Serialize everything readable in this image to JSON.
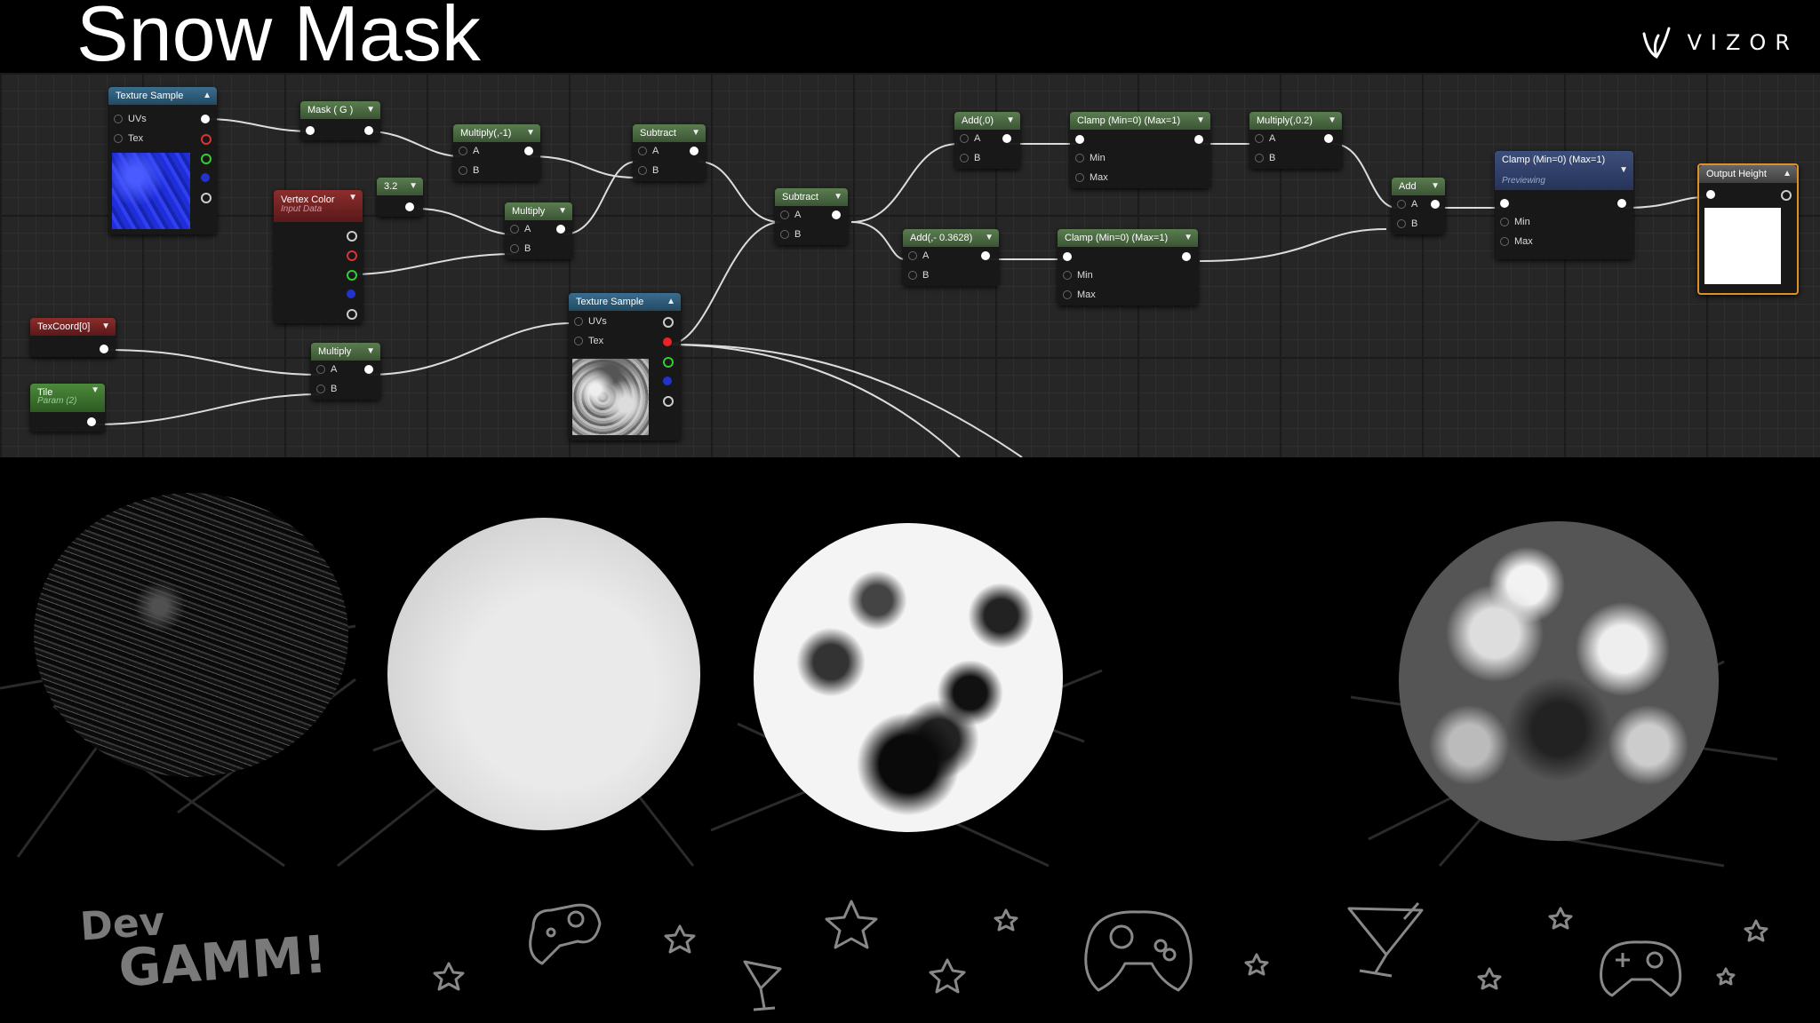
{
  "slide": {
    "title": "Snow Mask"
  },
  "brand": {
    "name": "VIZOR",
    "logo": "vizor-v-icon"
  },
  "graph": {
    "nodes": {
      "texture_sample_1": {
        "title": "Texture Sample",
        "pins": [
          "UVs",
          "Tex"
        ]
      },
      "mask_g": {
        "title": "Mask ( G )"
      },
      "multiply_neg1": {
        "title": "Multiply(,-1)",
        "pins": [
          "A",
          "B"
        ]
      },
      "subtract_1": {
        "title": "Subtract",
        "pins": [
          "A",
          "B"
        ]
      },
      "constant_32": {
        "title": "3.2"
      },
      "vertex_color": {
        "title": "Vertex Color",
        "subtitle": "Input Data"
      },
      "multiply_1": {
        "title": "Multiply",
        "pins": [
          "A",
          "B"
        ]
      },
      "subtract_2": {
        "title": "Subtract",
        "pins": [
          "A",
          "B"
        ]
      },
      "add_0": {
        "title": "Add(,0)",
        "pins": [
          "A",
          "B"
        ]
      },
      "add_neg": {
        "title": "Add(,- 0.3628)",
        "pins": [
          "A",
          "B"
        ]
      },
      "clamp_1": {
        "title": "Clamp (Min=0) (Max=1)",
        "pins": [
          "Min",
          "Max"
        ]
      },
      "clamp_2": {
        "title": "Clamp (Min=0) (Max=1)",
        "pins": [
          "Min",
          "Max"
        ]
      },
      "multiply_02": {
        "title": "Multiply(,0.2)",
        "pins": [
          "A",
          "B"
        ]
      },
      "add_final": {
        "title": "Add",
        "pins": [
          "A",
          "B"
        ]
      },
      "clamp_3": {
        "title": "Clamp (Min=0) (Max=1)",
        "subtitle": "Previewing",
        "pins": [
          "Min",
          "Max"
        ]
      },
      "output_height": {
        "title": "Output Height"
      },
      "texcoord": {
        "title": "TexCoord[0]"
      },
      "tile": {
        "title": "Tile",
        "subtitle": "Param (2)"
      },
      "multiply_2": {
        "title": "Multiply",
        "pins": [
          "A",
          "B"
        ]
      },
      "texture_sample_2": {
        "title": "Texture Sample",
        "pins": [
          "UVs",
          "Tex"
        ]
      }
    }
  },
  "footer": {
    "event_logo_line1": "Dev",
    "event_logo_line2": "GAMM!"
  },
  "icons": [
    "gamepad-icon",
    "star-icon",
    "cocktail-icon"
  ]
}
